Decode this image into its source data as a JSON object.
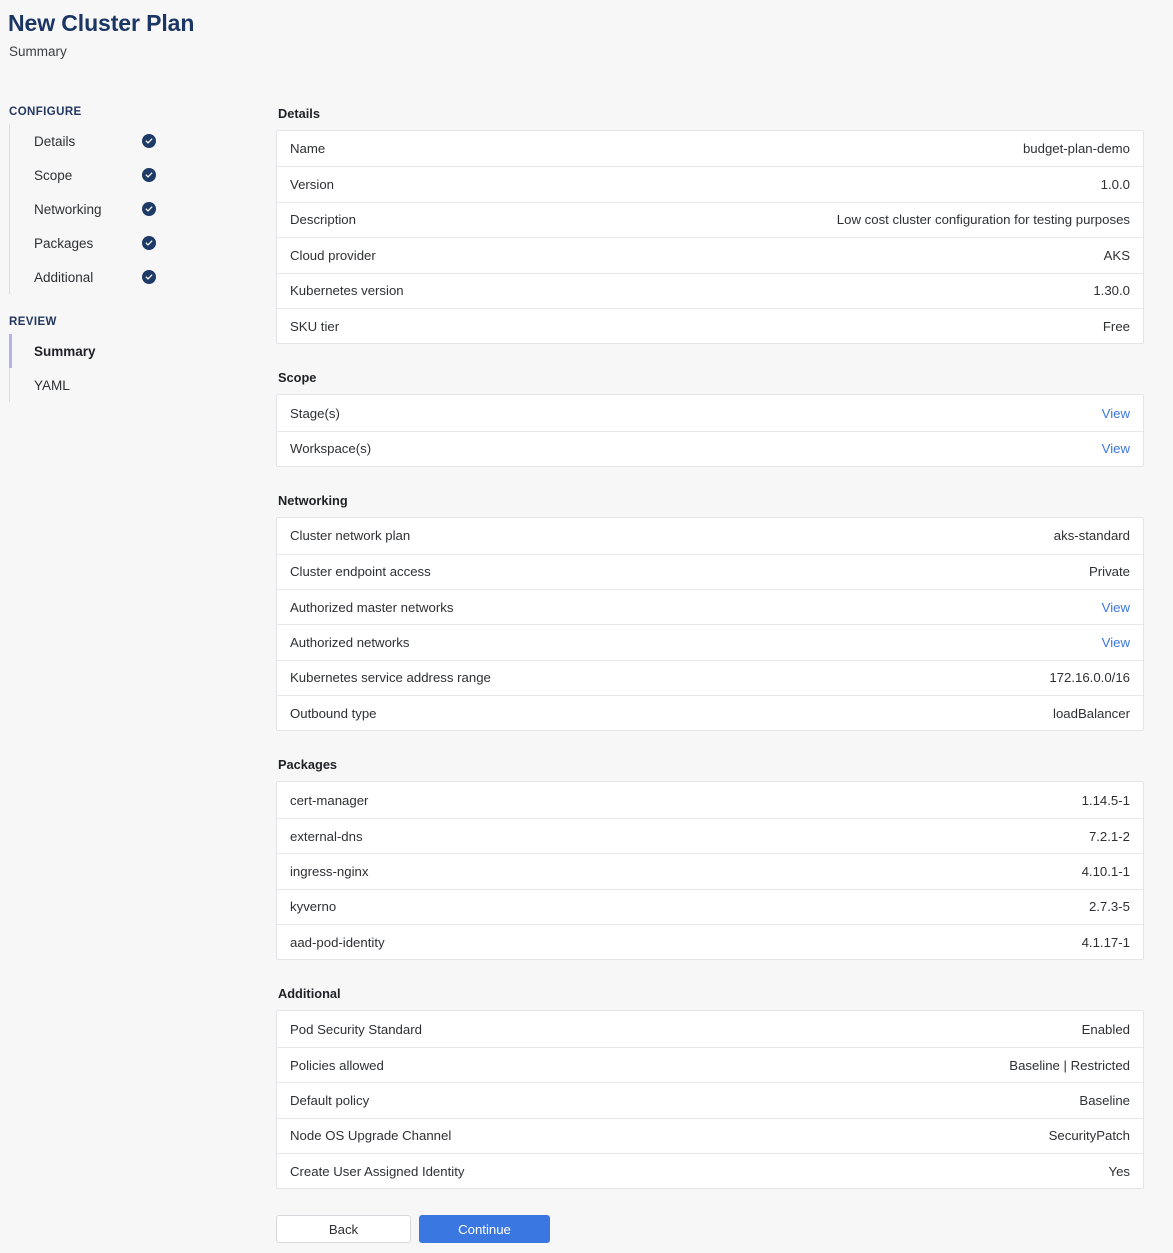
{
  "header": {
    "title": "New Cluster Plan",
    "subtitle": "Summary"
  },
  "sidebar": {
    "configure": {
      "group_label": "CONFIGURE",
      "items": [
        {
          "label": "Details",
          "status_icon": "check-circle-icon",
          "complete": true
        },
        {
          "label": "Scope",
          "status_icon": "check-circle-icon",
          "complete": true
        },
        {
          "label": "Networking",
          "status_icon": "check-circle-icon",
          "complete": true
        },
        {
          "label": "Packages",
          "status_icon": "check-circle-icon",
          "complete": true
        },
        {
          "label": "Additional",
          "status_icon": "check-circle-icon",
          "complete": true
        }
      ]
    },
    "review": {
      "group_label": "REVIEW",
      "items": [
        {
          "label": "Summary",
          "active": true
        },
        {
          "label": "YAML",
          "active": false
        }
      ]
    },
    "active_indicator_color": "#b6b2ef"
  },
  "sections": [
    {
      "title": "Details",
      "rows": [
        {
          "key": "Name",
          "value": "budget-plan-demo",
          "is_link": false
        },
        {
          "key": "Version",
          "value": "1.0.0",
          "is_link": false
        },
        {
          "key": "Description",
          "value": "Low cost cluster configuration for testing purposes",
          "is_link": false
        },
        {
          "key": "Cloud provider",
          "value": "AKS",
          "is_link": false
        },
        {
          "key": "Kubernetes version",
          "value": "1.30.0",
          "is_link": false
        },
        {
          "key": "SKU tier",
          "value": "Free",
          "is_link": false
        }
      ]
    },
    {
      "title": "Scope",
      "rows": [
        {
          "key": "Stage(s)",
          "value": "View",
          "is_link": true
        },
        {
          "key": "Workspace(s)",
          "value": "View",
          "is_link": true
        }
      ]
    },
    {
      "title": "Networking",
      "rows": [
        {
          "key": "Cluster network plan",
          "value": "aks-standard",
          "is_link": false
        },
        {
          "key": "Cluster endpoint access",
          "value": "Private",
          "is_link": false
        },
        {
          "key": "Authorized master networks",
          "value": "View",
          "is_link": true
        },
        {
          "key": "Authorized networks",
          "value": "View",
          "is_link": true
        },
        {
          "key": "Kubernetes service address range",
          "value": "172.16.0.0/16",
          "is_link": false
        },
        {
          "key": "Outbound type",
          "value": "loadBalancer",
          "is_link": false
        }
      ]
    },
    {
      "title": "Packages",
      "rows": [
        {
          "key": "cert-manager",
          "value": "1.14.5-1",
          "is_link": false
        },
        {
          "key": "external-dns",
          "value": "7.2.1-2",
          "is_link": false
        },
        {
          "key": "ingress-nginx",
          "value": "4.10.1-1",
          "is_link": false
        },
        {
          "key": "kyverno",
          "value": "2.7.3-5",
          "is_link": false
        },
        {
          "key": "aad-pod-identity",
          "value": "4.1.17-1",
          "is_link": false
        }
      ]
    },
    {
      "title": "Additional",
      "rows": [
        {
          "key": "Pod Security Standard",
          "value": "Enabled",
          "is_link": false
        },
        {
          "key": "Policies allowed",
          "value": "Baseline | Restricted",
          "is_link": false
        },
        {
          "key": "Default policy",
          "value": "Baseline",
          "is_link": false
        },
        {
          "key": "Node OS Upgrade Channel",
          "value": "SecurityPatch",
          "is_link": false
        },
        {
          "key": "Create User Assigned Identity",
          "value": "Yes",
          "is_link": false
        }
      ]
    }
  ],
  "footer": {
    "back_label": "Back",
    "continue_label": "Continue",
    "primary_color": "#3b77e0"
  }
}
